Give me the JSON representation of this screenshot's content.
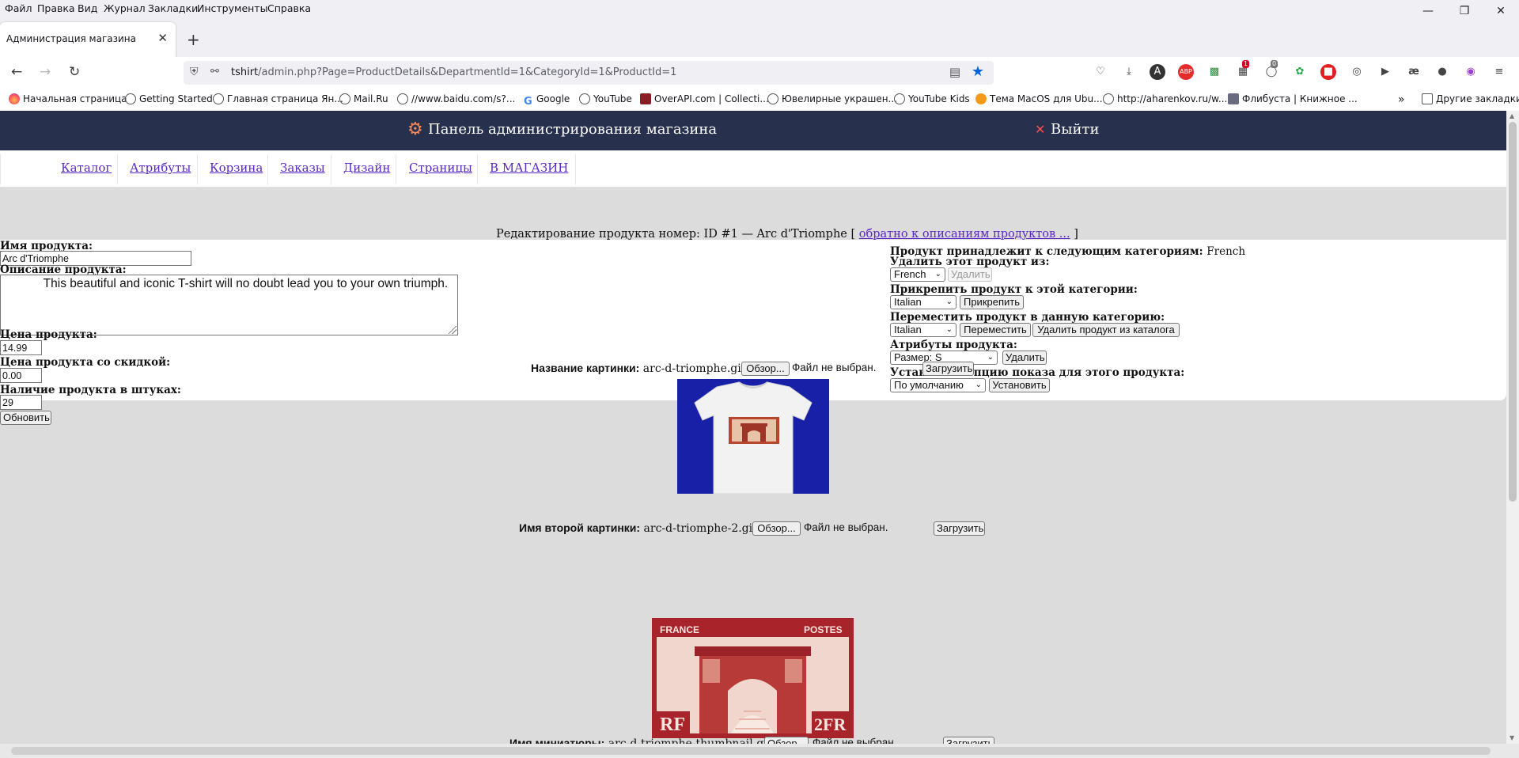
{
  "menu": [
    "Файл",
    "Правка",
    "Вид",
    "Журнал",
    "Закладки",
    "Инструменты",
    "Справка"
  ],
  "tab": {
    "title": "Администрация магазина"
  },
  "url": {
    "host": "tshirt",
    "path": "/admin.php?Page=ProductDetails&DepartmentId=1&CategoryId=1&ProductId=1"
  },
  "extensions": {
    "badge1": "1",
    "badge2": "0"
  },
  "bookmarks": [
    "Начальная страница",
    "Getting Started",
    "Главная страница Ян...",
    "Mail.Ru",
    "//www.baidu.com/s?...",
    "Google",
    "YouTube",
    "OverAPI.com | Collecti...",
    "Ювелирные украшен...",
    "YouTube Kids",
    "Тема MacOS для Ubu...",
    "http://aharenkov.ru/w...",
    "Флибуста | Книжное ...",
    "Другие закладки"
  ],
  "header": {
    "title": "Панель администрирования магазина",
    "logout": "Выйти"
  },
  "nav": [
    "Каталог",
    "Атрибуты",
    "Корзина",
    "Заказы",
    "Дизайн",
    "Страницы",
    "В МАГАЗИН"
  ],
  "heading": {
    "prefix": "Редактирование продукта номер: ID #1 — Arc d'Triomphe [",
    "link": "обратно к описаниям продуктов ...",
    "suffix": "]"
  },
  "form": {
    "name_label": "Имя продукта:",
    "name_value": "Arc d'Triomphe",
    "desc_label": "Описание продукта:",
    "desc_value": "            This beautiful and iconic T-shirt will no doubt lead you to your own triumph.",
    "price_label": "Цена продукта:",
    "price_value": "14.99",
    "discount_label": "Цена продукта со скидкой:",
    "discount_value": "0.00",
    "stock_label": "Наличие продукта в штуках:",
    "stock_value": "29",
    "update_button": "Обновить"
  },
  "categories": {
    "belongs_label": "Продукт принадлежит к следующим категориям:",
    "belongs_value": "French",
    "remove_label": "Удалить этот продукт из:",
    "remove_select": "French",
    "remove_button": "Удалить",
    "attach_label": "Прикрепить продукт к этой категории:",
    "attach_select": "Italian",
    "attach_button": "Прикрепить",
    "move_label": "Переместить продукт в данную категорию:",
    "move_select": "Italian",
    "move_button": "Переместить",
    "delete_button": "Удалить продукт из каталога",
    "attr_label": "Атрибуты продукта:",
    "attr_select": "Размер: S",
    "attr_button": "Удалить",
    "display_label": "Установить опцию показа для этого продукта:",
    "display_select": "По умолчанию",
    "display_button": "Установить"
  },
  "images": {
    "img1_label": "Название картинки:",
    "img1_file": "arc-d-triomphe.gif",
    "img2_label": "Имя второй картинки:",
    "img2_file": "arc-d-triomphe-2.gif",
    "img3_label": "Имя миниатюры:",
    "img3_file": "arc-d-triomphe-thumbnail.gif",
    "browse": "Обзор...",
    "nofile": "Файл не выбран.",
    "upload": "Загрузить",
    "stamp_top_left": "FRANCE",
    "stamp_top_right": "POSTES",
    "stamp_bottom_left": "RF",
    "stamp_bottom_right": "2FR"
  },
  "colors": {
    "header_bg": "#27304d",
    "link": "#5b27c6",
    "tshirt_bg": "#1820a8",
    "stamp_red": "#a8242a"
  }
}
